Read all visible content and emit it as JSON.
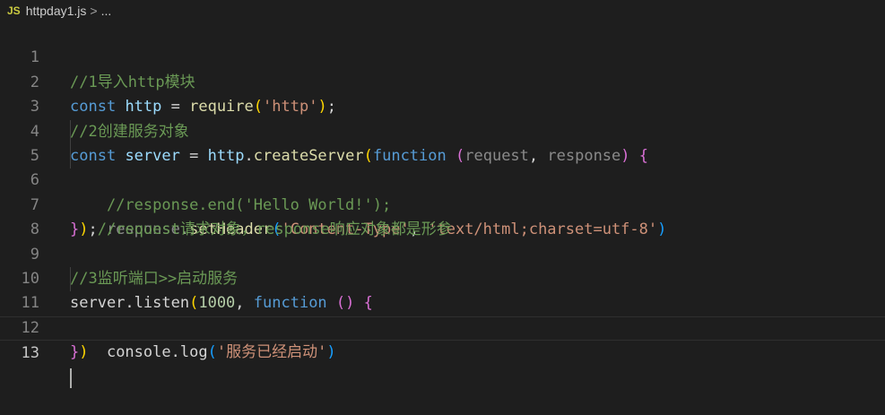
{
  "breadcrumb": {
    "file_icon": "JS",
    "file_name": "httpday1.js",
    "separator": ">",
    "more": "..."
  },
  "line_numbers": [
    "1",
    "2",
    "3",
    "4",
    "5",
    "6",
    "7",
    "8",
    "9",
    "10",
    "11",
    "12",
    "13"
  ],
  "code": {
    "l1_comment": "//1导入http模块",
    "l2_const": "const",
    "l2_var": "http",
    "l2_eq": " = ",
    "l2_func": "require",
    "l2_open": "(",
    "l2_str": "'http'",
    "l2_close": ")",
    "l2_semi": ";",
    "l3_comment": "//2创建服务对象",
    "l4_const": "const",
    "l4_var": "server",
    "l4_eq": " = ",
    "l4_obj": "http",
    "l4_dot": ".",
    "l4_method": "createServer",
    "l4_open": "(",
    "l4_function": "function",
    "l4_popen": "(",
    "l4_param1": "request",
    "l4_comma": ", ",
    "l4_param2": "response",
    "l4_pclose": ")",
    "l4_brace": "{",
    "l5_comment": "//response.end('Hello World!');",
    "l6_obj": "response",
    "l6_dot": ".",
    "l6_method": "setHeader",
    "l6_open": "(",
    "l6_str1": "'Content-Type'",
    "l6_comma": ", ",
    "l6_str2": "'text/html;charset=utf-8'",
    "l6_close": ")",
    "l7_brace": "}",
    "l7_paren": ")",
    "l7_semi": ";",
    "l7_comment": "//request请求对象，response响应对象都是形参",
    "l9_comment": "//3监听端口>>启动服务",
    "l10_obj": "server",
    "l10_dot": ".",
    "l10_method": "listen",
    "l10_open": "(",
    "l10_num": "1000",
    "l10_comma": ", ",
    "l10_function": "function",
    "l10_parens": "()",
    "l10_brace": "{",
    "l11_obj": "console",
    "l11_dot": ".",
    "l11_method": "log",
    "l11_open": "(",
    "l11_str": "'服务已经启动'",
    "l11_close": ")",
    "l12_brace": "}",
    "l12_paren": ")"
  }
}
